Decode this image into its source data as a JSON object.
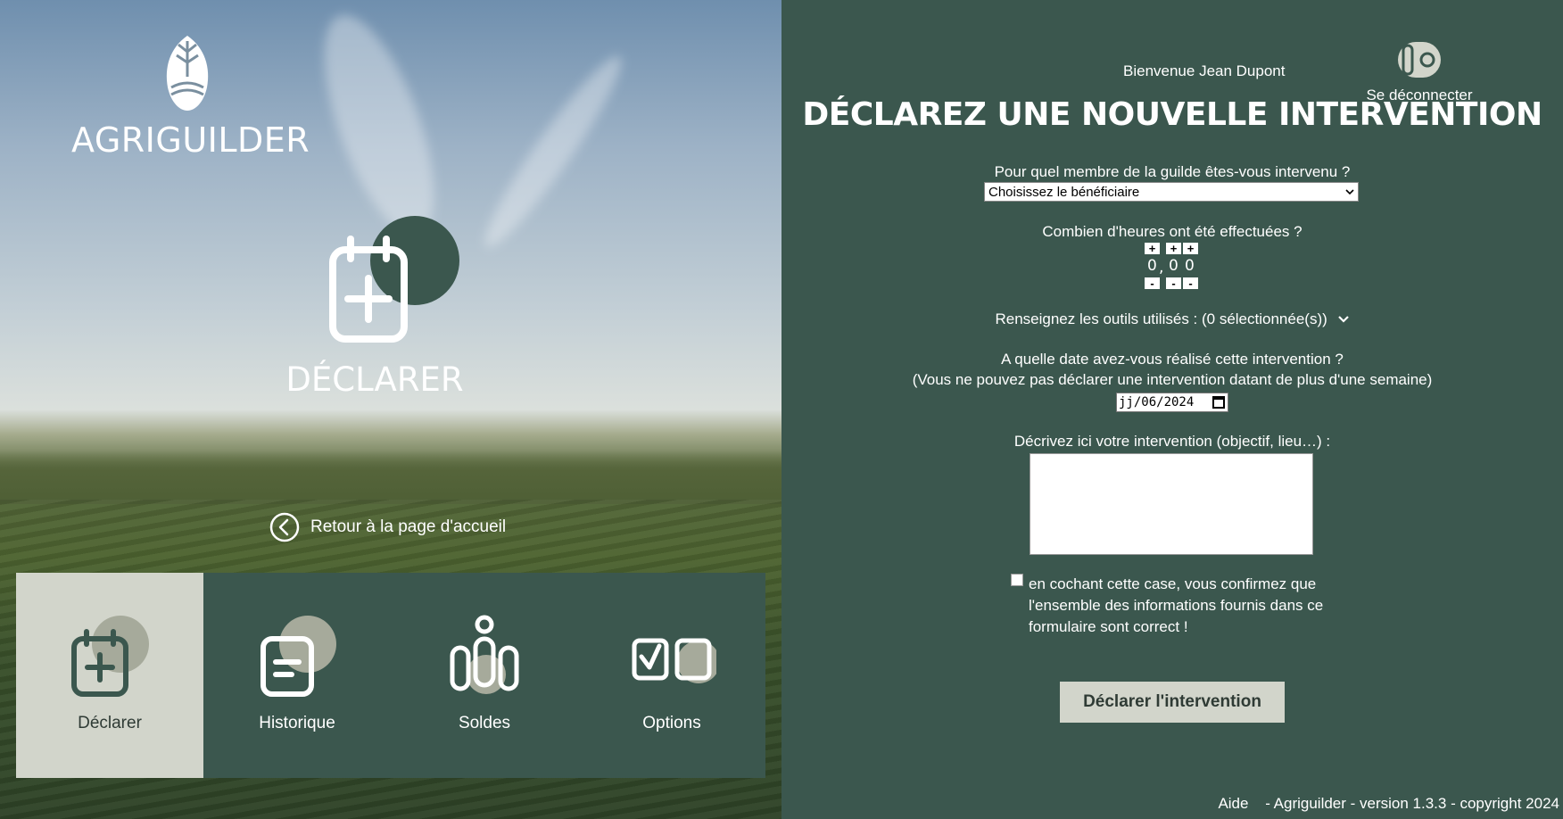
{
  "brand": {
    "name": "AGRIGUILDER"
  },
  "hero": {
    "title": "DÉCLARER"
  },
  "back_link": {
    "label": "Retour à la page d'accueil"
  },
  "nav": {
    "items": [
      {
        "label": "Déclarer",
        "icon": "calendar-plus-icon",
        "active": true
      },
      {
        "label": "Historique",
        "icon": "document-icon",
        "active": false
      },
      {
        "label": "Soldes",
        "icon": "people-icon",
        "active": false
      },
      {
        "label": "Options",
        "icon": "checkbox-icon",
        "active": false
      }
    ]
  },
  "header": {
    "welcome": "Bienvenue Jean Dupont",
    "logout_label": "Se déconnecter",
    "title": "DÉCLAREZ UNE NOUVELLE INTERVENTION"
  },
  "form": {
    "member_question": "Pour quel membre de la guilde êtes-vous intervenu ?",
    "member_select": "Choisissez le bénéficiaire",
    "hours_question": "Combien d'heures ont été effectuées ?",
    "hours": {
      "d1": "0",
      "sep": ",",
      "d2": "0",
      "d3": "0",
      "plus": "+",
      "minus": "-"
    },
    "tools_label": "Renseignez les outils utilisés : (0 sélectionnée(s))",
    "date_question": "A quelle date avez-vous réalisé cette intervention ?",
    "date_note": "(Vous ne pouvez pas déclarer une intervention datant de plus d'une semaine)",
    "date_value": "jj/06/2024",
    "desc_question": "Décrivez ici votre intervention (objectif, lieu…) :",
    "desc_value": "",
    "confirm_text": "en cochant cette case, vous confirmez que l'ensemble des informations fournis dans ce formulaire sont correct !",
    "submit_label": "Déclarer l'intervention"
  },
  "footer": {
    "help": "Aide",
    "info": "- Agriguilder - version 1.3.3 - copyright 2024"
  },
  "colors": {
    "panel": "#3b574e",
    "accent_light": "#d2d5cb"
  }
}
